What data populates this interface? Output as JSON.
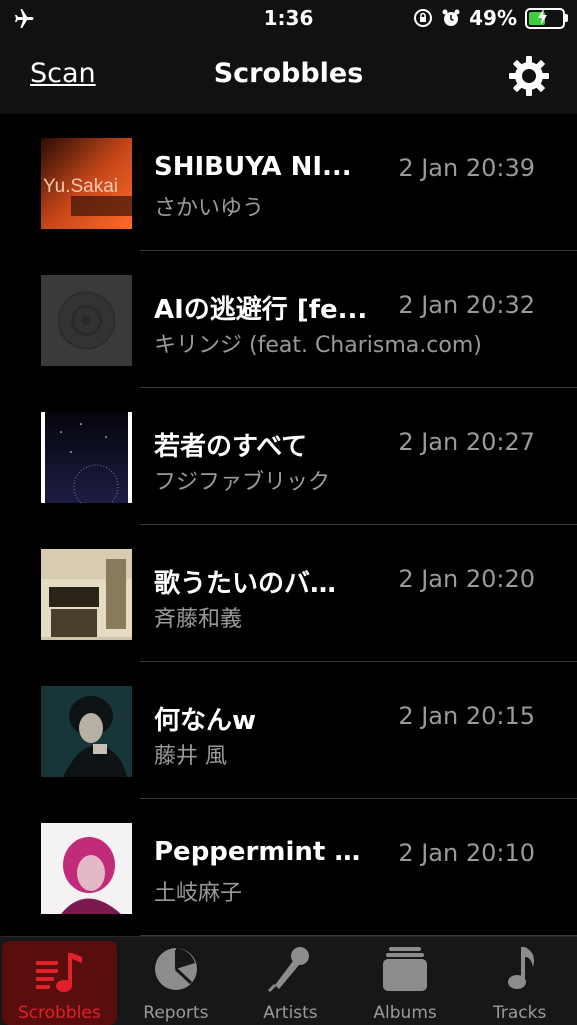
{
  "status_bar": {
    "time": "1:36",
    "battery": "49%",
    "battery_level": 0.49
  },
  "nav": {
    "scan_label": "Scan",
    "title": "Scrobbles",
    "settings_icon": "gear-icon"
  },
  "scrobbles": [
    {
      "title": "SHIBUYA NI...",
      "artist": "さかいゆう",
      "date": "2 Jan 20:39",
      "art_text": "Yu.Sakai"
    },
    {
      "title": "AIの逃避行 [fe...",
      "artist": "キリンジ (feat. Charisma.com)",
      "date": "2 Jan 20:32"
    },
    {
      "title": "若者のすべて",
      "artist": "フジファブリック",
      "date": "2 Jan 20:27"
    },
    {
      "title": "歌うたいのバ…",
      "artist": "斉藤和義",
      "date": "2 Jan 20:20"
    },
    {
      "title": "何なんw",
      "artist": "藤井 風",
      "date": "2 Jan 20:15"
    },
    {
      "title": "Peppermint T...",
      "artist": "土岐麻子",
      "date": "2 Jan 20:10"
    }
  ],
  "tabs": [
    {
      "label": "Scrobbles",
      "icon": "music-list-icon",
      "active": true
    },
    {
      "label": "Reports",
      "icon": "pie-chart-icon",
      "active": false
    },
    {
      "label": "Artists",
      "icon": "microphone-icon",
      "active": false
    },
    {
      "label": "Albums",
      "icon": "album-stack-icon",
      "active": false
    },
    {
      "label": "Tracks",
      "icon": "music-note-icon",
      "active": false
    }
  ],
  "colors": {
    "accent": "#e0202a",
    "background": "#000000",
    "secondary_text": "#9a9a9a"
  }
}
